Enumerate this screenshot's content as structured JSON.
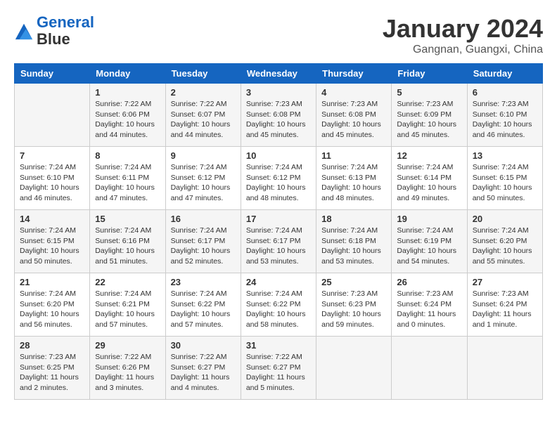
{
  "header": {
    "logo_line1": "General",
    "logo_line2": "Blue",
    "month_title": "January 2024",
    "subtitle": "Gangnan, Guangxi, China"
  },
  "days_of_week": [
    "Sunday",
    "Monday",
    "Tuesday",
    "Wednesday",
    "Thursday",
    "Friday",
    "Saturday"
  ],
  "weeks": [
    [
      {
        "day": "",
        "sunrise": "",
        "sunset": "",
        "daylight": ""
      },
      {
        "day": "1",
        "sunrise": "Sunrise: 7:22 AM",
        "sunset": "Sunset: 6:06 PM",
        "daylight": "Daylight: 10 hours and 44 minutes."
      },
      {
        "day": "2",
        "sunrise": "Sunrise: 7:22 AM",
        "sunset": "Sunset: 6:07 PM",
        "daylight": "Daylight: 10 hours and 44 minutes."
      },
      {
        "day": "3",
        "sunrise": "Sunrise: 7:23 AM",
        "sunset": "Sunset: 6:08 PM",
        "daylight": "Daylight: 10 hours and 45 minutes."
      },
      {
        "day": "4",
        "sunrise": "Sunrise: 7:23 AM",
        "sunset": "Sunset: 6:08 PM",
        "daylight": "Daylight: 10 hours and 45 minutes."
      },
      {
        "day": "5",
        "sunrise": "Sunrise: 7:23 AM",
        "sunset": "Sunset: 6:09 PM",
        "daylight": "Daylight: 10 hours and 45 minutes."
      },
      {
        "day": "6",
        "sunrise": "Sunrise: 7:23 AM",
        "sunset": "Sunset: 6:10 PM",
        "daylight": "Daylight: 10 hours and 46 minutes."
      }
    ],
    [
      {
        "day": "7",
        "sunrise": "Sunrise: 7:24 AM",
        "sunset": "Sunset: 6:10 PM",
        "daylight": "Daylight: 10 hours and 46 minutes."
      },
      {
        "day": "8",
        "sunrise": "Sunrise: 7:24 AM",
        "sunset": "Sunset: 6:11 PM",
        "daylight": "Daylight: 10 hours and 47 minutes."
      },
      {
        "day": "9",
        "sunrise": "Sunrise: 7:24 AM",
        "sunset": "Sunset: 6:12 PM",
        "daylight": "Daylight: 10 hours and 47 minutes."
      },
      {
        "day": "10",
        "sunrise": "Sunrise: 7:24 AM",
        "sunset": "Sunset: 6:12 PM",
        "daylight": "Daylight: 10 hours and 48 minutes."
      },
      {
        "day": "11",
        "sunrise": "Sunrise: 7:24 AM",
        "sunset": "Sunset: 6:13 PM",
        "daylight": "Daylight: 10 hours and 48 minutes."
      },
      {
        "day": "12",
        "sunrise": "Sunrise: 7:24 AM",
        "sunset": "Sunset: 6:14 PM",
        "daylight": "Daylight: 10 hours and 49 minutes."
      },
      {
        "day": "13",
        "sunrise": "Sunrise: 7:24 AM",
        "sunset": "Sunset: 6:15 PM",
        "daylight": "Daylight: 10 hours and 50 minutes."
      }
    ],
    [
      {
        "day": "14",
        "sunrise": "Sunrise: 7:24 AM",
        "sunset": "Sunset: 6:15 PM",
        "daylight": "Daylight: 10 hours and 50 minutes."
      },
      {
        "day": "15",
        "sunrise": "Sunrise: 7:24 AM",
        "sunset": "Sunset: 6:16 PM",
        "daylight": "Daylight: 10 hours and 51 minutes."
      },
      {
        "day": "16",
        "sunrise": "Sunrise: 7:24 AM",
        "sunset": "Sunset: 6:17 PM",
        "daylight": "Daylight: 10 hours and 52 minutes."
      },
      {
        "day": "17",
        "sunrise": "Sunrise: 7:24 AM",
        "sunset": "Sunset: 6:17 PM",
        "daylight": "Daylight: 10 hours and 53 minutes."
      },
      {
        "day": "18",
        "sunrise": "Sunrise: 7:24 AM",
        "sunset": "Sunset: 6:18 PM",
        "daylight": "Daylight: 10 hours and 53 minutes."
      },
      {
        "day": "19",
        "sunrise": "Sunrise: 7:24 AM",
        "sunset": "Sunset: 6:19 PM",
        "daylight": "Daylight: 10 hours and 54 minutes."
      },
      {
        "day": "20",
        "sunrise": "Sunrise: 7:24 AM",
        "sunset": "Sunset: 6:20 PM",
        "daylight": "Daylight: 10 hours and 55 minutes."
      }
    ],
    [
      {
        "day": "21",
        "sunrise": "Sunrise: 7:24 AM",
        "sunset": "Sunset: 6:20 PM",
        "daylight": "Daylight: 10 hours and 56 minutes."
      },
      {
        "day": "22",
        "sunrise": "Sunrise: 7:24 AM",
        "sunset": "Sunset: 6:21 PM",
        "daylight": "Daylight: 10 hours and 57 minutes."
      },
      {
        "day": "23",
        "sunrise": "Sunrise: 7:24 AM",
        "sunset": "Sunset: 6:22 PM",
        "daylight": "Daylight: 10 hours and 57 minutes."
      },
      {
        "day": "24",
        "sunrise": "Sunrise: 7:24 AM",
        "sunset": "Sunset: 6:22 PM",
        "daylight": "Daylight: 10 hours and 58 minutes."
      },
      {
        "day": "25",
        "sunrise": "Sunrise: 7:23 AM",
        "sunset": "Sunset: 6:23 PM",
        "daylight": "Daylight: 10 hours and 59 minutes."
      },
      {
        "day": "26",
        "sunrise": "Sunrise: 7:23 AM",
        "sunset": "Sunset: 6:24 PM",
        "daylight": "Daylight: 11 hours and 0 minutes."
      },
      {
        "day": "27",
        "sunrise": "Sunrise: 7:23 AM",
        "sunset": "Sunset: 6:24 PM",
        "daylight": "Daylight: 11 hours and 1 minute."
      }
    ],
    [
      {
        "day": "28",
        "sunrise": "Sunrise: 7:23 AM",
        "sunset": "Sunset: 6:25 PM",
        "daylight": "Daylight: 11 hours and 2 minutes."
      },
      {
        "day": "29",
        "sunrise": "Sunrise: 7:22 AM",
        "sunset": "Sunset: 6:26 PM",
        "daylight": "Daylight: 11 hours and 3 minutes."
      },
      {
        "day": "30",
        "sunrise": "Sunrise: 7:22 AM",
        "sunset": "Sunset: 6:27 PM",
        "daylight": "Daylight: 11 hours and 4 minutes."
      },
      {
        "day": "31",
        "sunrise": "Sunrise: 7:22 AM",
        "sunset": "Sunset: 6:27 PM",
        "daylight": "Daylight: 11 hours and 5 minutes."
      },
      {
        "day": "",
        "sunrise": "",
        "sunset": "",
        "daylight": ""
      },
      {
        "day": "",
        "sunrise": "",
        "sunset": "",
        "daylight": ""
      },
      {
        "day": "",
        "sunrise": "",
        "sunset": "",
        "daylight": ""
      }
    ]
  ]
}
